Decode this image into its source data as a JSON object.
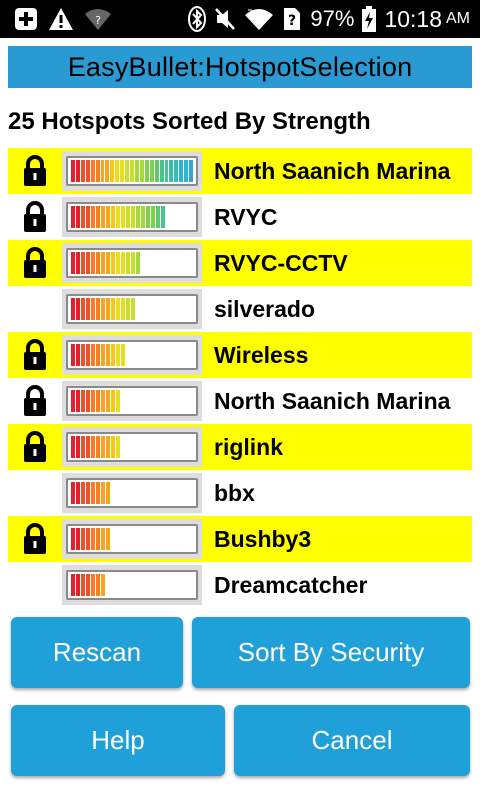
{
  "status_bar": {
    "battery_percent": "97%",
    "time": "10:18",
    "ampm": "AM",
    "icons": [
      "plus-square-icon",
      "warning-icon",
      "wifi-question-icon",
      "bluetooth-icon",
      "mute-icon",
      "wifi-icon",
      "unknown-sim-icon",
      "battery-charging-icon"
    ]
  },
  "app": {
    "title": "EasyBullet:HotspotSelection",
    "subtitle": "25 Hotspots Sorted By Strength"
  },
  "hotspots": [
    {
      "name": "North Saanich Marina",
      "secured": true,
      "highlighted": true,
      "strength": 1.0
    },
    {
      "name": "RVYC",
      "secured": true,
      "highlighted": false,
      "strength": 0.75
    },
    {
      "name": "RVYC-CCTV",
      "secured": true,
      "highlighted": true,
      "strength": 0.55
    },
    {
      "name": "silverado",
      "secured": false,
      "highlighted": false,
      "strength": 0.5
    },
    {
      "name": "Wireless",
      "secured": true,
      "highlighted": true,
      "strength": 0.45
    },
    {
      "name": "North Saanich Marina",
      "secured": true,
      "highlighted": false,
      "strength": 0.4
    },
    {
      "name": "riglink",
      "secured": true,
      "highlighted": true,
      "strength": 0.4
    },
    {
      "name": "bbx",
      "secured": false,
      "highlighted": false,
      "strength": 0.33
    },
    {
      "name": "Bushby3",
      "secured": true,
      "highlighted": true,
      "strength": 0.33
    },
    {
      "name": "Dreamcatcher",
      "secured": false,
      "highlighted": false,
      "strength": 0.27
    }
  ],
  "buttons": {
    "rescan": "Rescan",
    "sort_by_security": "Sort By Security",
    "help": "Help",
    "cancel": "Cancel"
  },
  "colors": {
    "title_bar": "#2a9ad3",
    "highlight": "#ffff00",
    "button": "#1fa0d8",
    "meter_gradient": [
      "#e3212a",
      "#f0502a",
      "#f57f23",
      "#f8a51c",
      "#f8c51c",
      "#e8de1a",
      "#c9e02a",
      "#a4d93a",
      "#7ed14e",
      "#5ec96a",
      "#49c48e",
      "#38bdb2",
      "#2fb4cf",
      "#2aa8dc"
    ]
  }
}
